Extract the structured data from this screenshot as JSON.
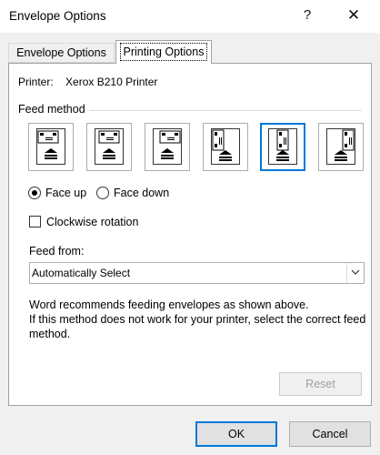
{
  "window": {
    "title": "Envelope Options",
    "help_glyph": "?",
    "close_glyph": "✕"
  },
  "tabs": [
    {
      "label": "Envelope Options",
      "selected": false
    },
    {
      "label": "Printing Options",
      "selected": true
    }
  ],
  "printing": {
    "printer_label": "Printer:",
    "printer_name": "Xerox B210 Printer",
    "feed_method_label": "Feed method",
    "feed_methods": [
      {
        "name": "horizontal-left",
        "selected": false
      },
      {
        "name": "horizontal-center",
        "selected": false
      },
      {
        "name": "horizontal-right",
        "selected": false
      },
      {
        "name": "vertical-left",
        "selected": false
      },
      {
        "name": "vertical-center",
        "selected": true
      },
      {
        "name": "vertical-right",
        "selected": false
      }
    ],
    "face_up_label": "Face up",
    "face_down_label": "Face down",
    "face_selection": "Face up",
    "clockwise_label": "Clockwise rotation",
    "clockwise_checked": false,
    "feed_from_label": "Feed from:",
    "feed_from_value": "Automatically Select",
    "note_line1": "Word recommends feeding envelopes as shown above.",
    "note_line2": "If this method does not work for your printer, select the correct feed method.",
    "reset_label": "Reset"
  },
  "footer": {
    "ok_label": "OK",
    "cancel_label": "Cancel"
  },
  "colors": {
    "accent": "#0078d7",
    "dialog_bg": "#f0f0f0",
    "panel_bg": "#ffffff"
  }
}
